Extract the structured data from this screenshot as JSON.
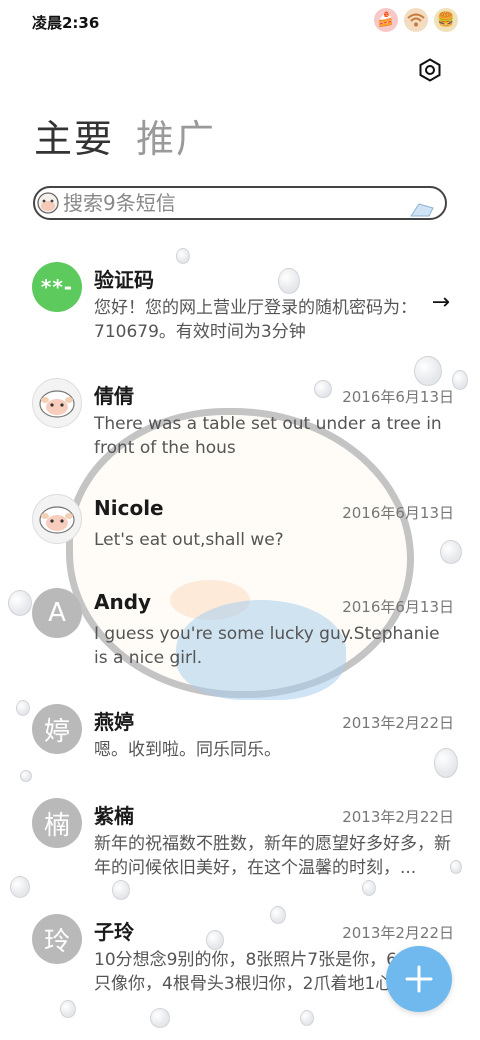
{
  "status_bar": {
    "time": "凌晨2:36",
    "icons": [
      "cake-icon",
      "wifi-icon",
      "battery-icon"
    ]
  },
  "header": {
    "settings_icon": "settings-icon"
  },
  "tabs": [
    {
      "label": "主要",
      "active": true
    },
    {
      "label": "推广",
      "active": false
    }
  ],
  "search": {
    "placeholder": "搜索9条短信"
  },
  "messages": [
    {
      "name": "验证码",
      "date": "",
      "avatar_text": "**-",
      "avatar_type": "green",
      "body": "您好！您的网上营业厅登录的随机密码为：710679。有效时间为3分钟",
      "has_arrow": true
    },
    {
      "name": "倩倩",
      "date": "2016年6月13日",
      "avatar_text": "",
      "avatar_type": "sheep",
      "body": "There was a table set out under a tree in front of the hous"
    },
    {
      "name": "Nicole",
      "date": "2016年6月13日",
      "avatar_text": "",
      "avatar_type": "sheep",
      "body": "Let's eat out,shall we?"
    },
    {
      "name": "Andy",
      "date": "2016年6月13日",
      "avatar_text": "A",
      "avatar_type": "letter",
      "body": "I guess you're some lucky guy.Stephanie is a nice girl."
    },
    {
      "name": "燕婷",
      "date": "2013年2月22日",
      "avatar_text": "婷",
      "avatar_type": "letter",
      "body": "嗯。收到啦。同乐同乐。"
    },
    {
      "name": "紫楠",
      "date": "2013年2月22日",
      "avatar_text": "楠",
      "avatar_type": "letter",
      "body": "新年的祝福数不胜数，新年的愿望好多好多，新年的问候依旧美好，在这个温馨的时刻，..."
    },
    {
      "name": "子玲",
      "date": "2013年2月22日",
      "avatar_text": "玲",
      "avatar_type": "letter",
      "body": "10分想念9别的你，8张照片7张是你，6句话5只像你，4根骨头3根归你，2爪着地1心想你"
    }
  ],
  "fab": {
    "icon": "plus-icon"
  },
  "colors": {
    "accent": "#6fb9ee",
    "verify_green": "#5cca5c",
    "avatar_gray": "#b9b9b9"
  }
}
